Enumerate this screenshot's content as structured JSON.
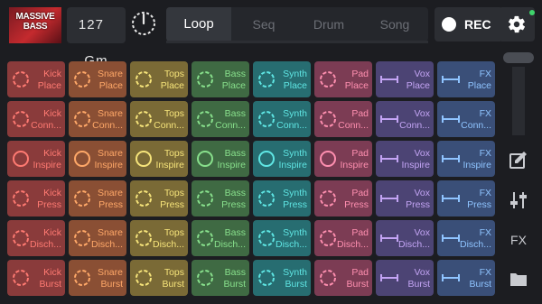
{
  "header": {
    "album_line1": "MASSIVE",
    "album_line2": "BASS",
    "bpm": "127",
    "key": "Gm",
    "tabs": [
      {
        "label": "Loop",
        "active": true
      },
      {
        "label": "Seq",
        "active": false
      },
      {
        "label": "Drum",
        "active": false
      },
      {
        "label": "Song",
        "active": false
      }
    ],
    "rec_label": "REC",
    "settings_icon": "gear-icon",
    "status_color": "#3fd46b"
  },
  "columns": [
    {
      "name": "Kick",
      "icon": "ring-icon",
      "color": "#ff7a72",
      "bg": "#8a3b3b"
    },
    {
      "name": "Snare",
      "icon": "ring-icon",
      "color": "#ffa868",
      "bg": "#8a4f34"
    },
    {
      "name": "Tops",
      "icon": "ring-icon",
      "color": "#f6e47a",
      "bg": "#7a6a36"
    },
    {
      "name": "Bass",
      "icon": "ring-icon",
      "color": "#88e08c",
      "bg": "#3f6a43"
    },
    {
      "name": "Synth",
      "icon": "ring-icon",
      "color": "#5fe6e4",
      "bg": "#276d71"
    },
    {
      "name": "Pad",
      "icon": "ring-icon",
      "color": "#ff8fb0",
      "bg": "#7c3c54"
    },
    {
      "name": "Vox",
      "icon": "bar-icon",
      "color": "#c3a4f4",
      "bg": "#4c4474"
    },
    {
      "name": "FX",
      "icon": "bar-icon",
      "color": "#8fc4ff",
      "bg": "#3a4f78"
    }
  ],
  "rows": [
    "Place",
    "Conn...",
    "Inspire",
    "Press",
    "Disch...",
    "Burst"
  ],
  "sidebar": {
    "edit_icon": "edit-icon",
    "mixer_icon": "sliders-icon",
    "fx_label": "FX",
    "folder_icon": "folder-icon"
  }
}
